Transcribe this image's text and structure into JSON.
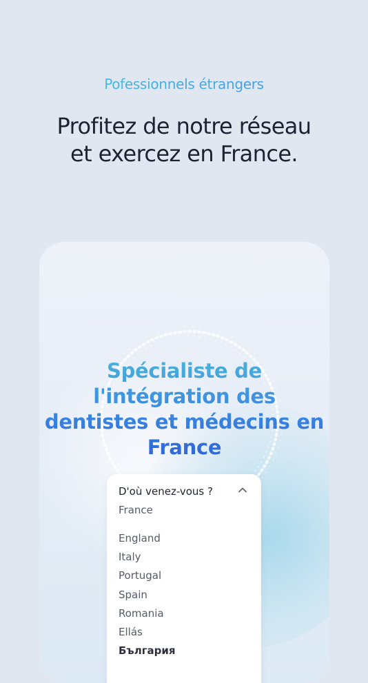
{
  "header": {
    "eyebrow": "Pofessionnels étrangers",
    "headline_line1": "Profitez de notre réseau",
    "headline_line2": "et exercez en France."
  },
  "card": {
    "title_line1": "Spécialiste de",
    "title_line2": "l'intégration des",
    "title_line3": "dentistes et médecins en",
    "title_line4": "France"
  },
  "dropdown": {
    "label": "D'où venez-vous ?",
    "selected": "France",
    "chevron_icon": "chevron-up-icon",
    "options": [
      "England",
      "Italy",
      "Portugal",
      "Spain",
      "Romania",
      "Ellás",
      "България"
    ]
  },
  "colors": {
    "background": "#e1e7f1",
    "headline": "#1c2333",
    "accent_start": "#4cc6d6",
    "accent_end": "#2f63d8"
  }
}
